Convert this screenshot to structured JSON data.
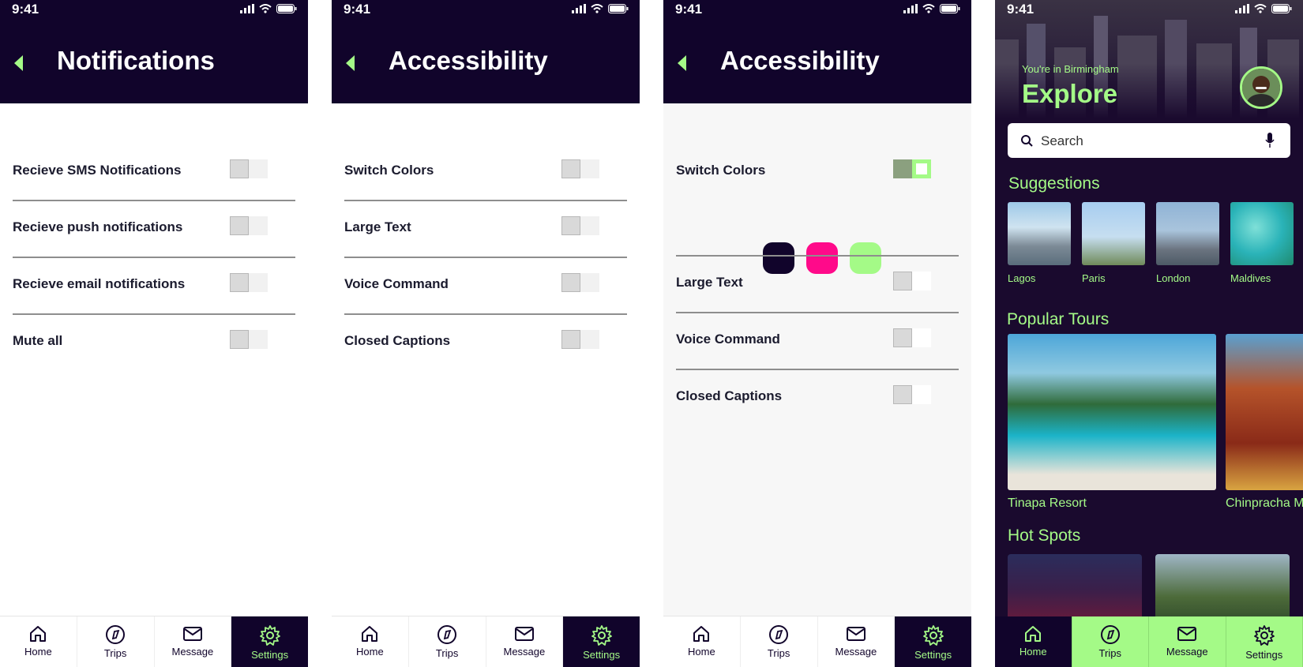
{
  "status": {
    "time": "9:41"
  },
  "colors": {
    "navy": "#11042b",
    "accent": "#a4fa87",
    "pink": "#ff0a8a",
    "light_green": "#a4fa87",
    "dark": "#11042b"
  },
  "notifications": {
    "title": "Notifications",
    "rows": [
      {
        "label": "Recieve SMS Notifications",
        "on": false
      },
      {
        "label": "Recieve push notifications",
        "on": false
      },
      {
        "label": "Recieve email notifications",
        "on": false
      },
      {
        "label": "Mute all",
        "on": false
      }
    ]
  },
  "accessibility": {
    "title": "Accessibility",
    "rows": [
      {
        "label": "Switch Colors",
        "on": false
      },
      {
        "label": "Large Text",
        "on": false
      },
      {
        "label": "Voice Command",
        "on": false
      },
      {
        "label": "Closed Captions",
        "on": false
      }
    ]
  },
  "accessibility2": {
    "title": "Accessibility",
    "rows": [
      {
        "label": "Switch Colors",
        "on": true
      },
      {
        "label": "Large Text",
        "on": false
      },
      {
        "label": "Voice Command",
        "on": false
      },
      {
        "label": "Closed Captions",
        "on": false
      }
    ],
    "swatches": [
      "#11042b",
      "#ff0a8a",
      "#a4fa87"
    ]
  },
  "tabs": [
    {
      "label": "Home",
      "icon": "home-icon"
    },
    {
      "label": "Trips",
      "icon": "compass-icon"
    },
    {
      "label": "Message",
      "icon": "mail-icon"
    },
    {
      "label": "Settings",
      "icon": "gear-icon"
    }
  ],
  "explore": {
    "location": "You're in Birmingham",
    "title": "Explore",
    "search_placeholder": "Search",
    "suggestions_title": "Suggestions",
    "suggestions": [
      {
        "name": "Lagos"
      },
      {
        "name": "Paris"
      },
      {
        "name": "London"
      },
      {
        "name": "Maldives"
      }
    ],
    "tours_title": "Popular Tours",
    "tours": [
      {
        "name": "Tinapa Resort"
      },
      {
        "name": "Chinpracha M"
      }
    ],
    "hotspots_title": "Hot Spots"
  }
}
